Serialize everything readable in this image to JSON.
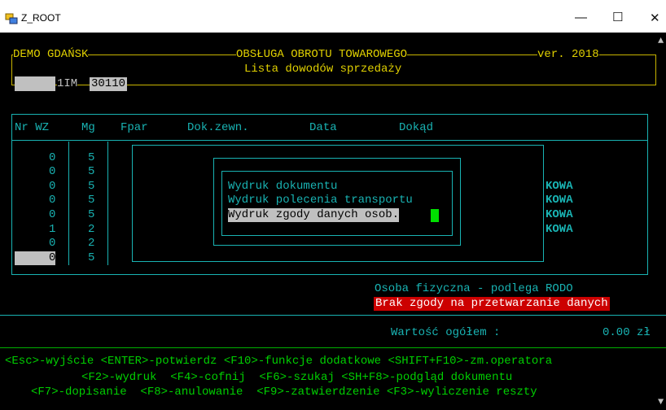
{
  "window": {
    "title": "Z_ROOT"
  },
  "header": {
    "location": "DEMO GDAŃSK",
    "module_title": "OBSŁUGA OBROTU TOWAROWEGO",
    "version": "ver. 2018",
    "subtitle": "Lista dowodów sprzedaży",
    "doc_code": "1IM",
    "doc_number": "30110"
  },
  "table": {
    "columns": [
      "Nr WZ",
      "Mg",
      "Fpar",
      "Dok.zewn.",
      "Data",
      "Dokąd"
    ],
    "rows": [
      {
        "nr": "0",
        "mg": "5",
        "dokad": ""
      },
      {
        "nr": "0",
        "mg": "5",
        "dokad": ""
      },
      {
        "nr": "0",
        "mg": "5",
        "dokad": "KOWA"
      },
      {
        "nr": "0",
        "mg": "5",
        "dokad": "KOWA"
      },
      {
        "nr": "0",
        "mg": "5",
        "dokad": "KOWA"
      },
      {
        "nr": "1",
        "mg": "2",
        "dokad": "KOWA"
      },
      {
        "nr": "0",
        "mg": "2",
        "dokad": ""
      },
      {
        "nr": "0",
        "mg": "5",
        "dokad": ""
      }
    ]
  },
  "print_menu": {
    "items": [
      "Wydruk dokumentu",
      "Wydruk polecenia transportu",
      "Wydruk zgody danych osob."
    ],
    "selected_index": 2
  },
  "status": {
    "person_type": "Osoba fizyczna - podlega RODO",
    "consent_warning": "Brak zgody na przetwarzanie danych",
    "total_label": "Wartość ogółem :",
    "total_value": "0.00 zł"
  },
  "shortcuts": {
    "line1": "<Esc>-wyjście <ENTER>-potwierdz <F10>-funkcje dodatkowe <SHIFT+F10>-zm.operatora",
    "line2": "<F2>-wydruk  <F4>-cofnij  <F6>-szukaj <SH+F8>-podgląd dokumentu",
    "line3": "<F7>-dopisanie  <F8>-anulowanie  <F9>-zatwierdzenie <F3>-wyliczenie reszty"
  },
  "colors": {
    "accent_cyan": "#19b3b3",
    "header_yellow": "#e0d000",
    "shortcut_green": "#00d000",
    "warning_bg": "#cc0000"
  }
}
